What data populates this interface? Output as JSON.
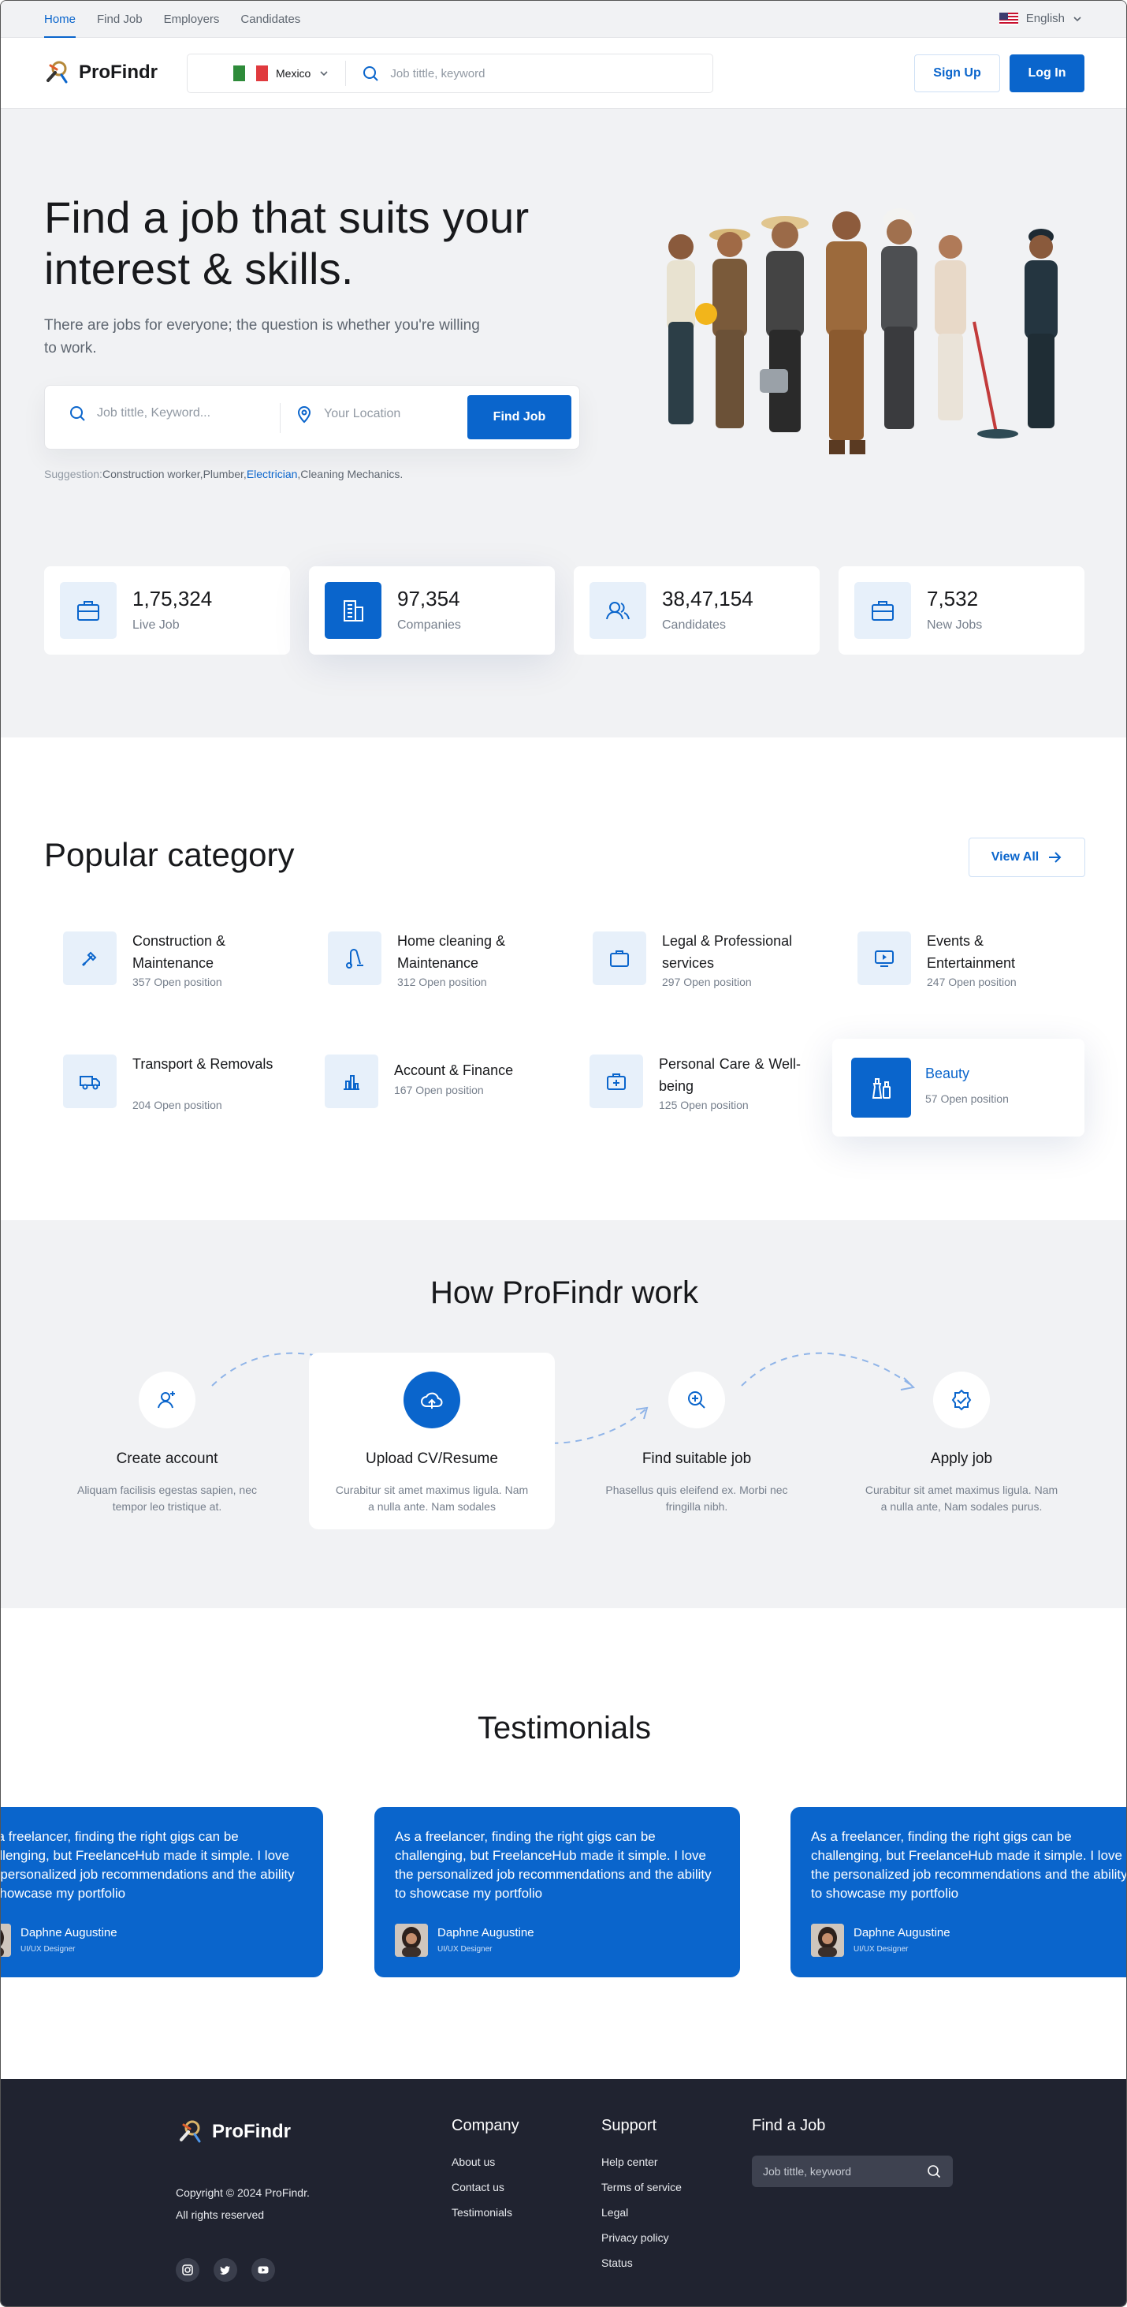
{
  "topnav": {
    "links": [
      "Home",
      "Find Job",
      "Employers",
      "Candidates"
    ],
    "language": "English"
  },
  "header": {
    "brand": "ProFindr",
    "country": "Mexico",
    "search_placeholder": "Job tittle, keyword",
    "signup": "Sign Up",
    "login": "Log In"
  },
  "hero": {
    "title": "Find a job that suits your interest & skills.",
    "subtitle": "There are jobs for everyone; the question is whether you're willing to work.",
    "job_placeholder": "Job tittle, Keyword...",
    "location_placeholder": "Your Location",
    "find_button": "Find Job",
    "suggestion_label": "Suggestion:",
    "suggestions": [
      "Construction worker,",
      "Plumber,",
      "Electrician",
      ",Cleaning Mechanics."
    ]
  },
  "stats": [
    {
      "value": "1,75,324",
      "label": "Live Job",
      "icon": "briefcase-icon"
    },
    {
      "value": "97,354",
      "label": "Companies",
      "icon": "building-icon"
    },
    {
      "value": "38,47,154",
      "label": "Candidates",
      "icon": "users-icon"
    },
    {
      "value": "7,532",
      "label": "New Jobs",
      "icon": "briefcase-icon"
    }
  ],
  "popular": {
    "title": "Popular category",
    "view_all": "View All",
    "categories": [
      {
        "name": "Construction & Maintenance",
        "count": "357 Open position",
        "icon": "tool-icon"
      },
      {
        "name": "Home cleaning & Maintenance",
        "count": "312 Open position",
        "icon": "vacuum-icon"
      },
      {
        "name": "Legal & Professional services",
        "count": "297 Open position",
        "icon": "briefcase-icon"
      },
      {
        "name": "Events & Entertainment",
        "count": "247 Open position",
        "icon": "play-screen-icon"
      },
      {
        "name": "Transport & Removals",
        "count": "204 Open position",
        "icon": "truck-icon"
      },
      {
        "name": "Account & Finance",
        "count": "167 Open position",
        "icon": "bar-chart-icon"
      },
      {
        "name": "Personal Care & Well-being",
        "count": "125 Open position",
        "icon": "first-aid-icon"
      },
      {
        "name": "Beauty",
        "count": "57 Open position",
        "icon": "beauty-icon"
      }
    ]
  },
  "how": {
    "title": "How ProFindr work",
    "steps": [
      {
        "title": "Create account",
        "desc": "Aliquam facilisis egestas sapien, nec tempor leo tristique at.",
        "icon": "user-plus-icon"
      },
      {
        "title": "Upload CV/Resume",
        "desc": "Curabitur sit amet maximus ligula. Nam a nulla ante. Nam sodales",
        "icon": "cloud-upload-icon"
      },
      {
        "title": "Find suitable job",
        "desc": "Phasellus quis eleifend ex. Morbi nec fringilla nibh.",
        "icon": "search-plus-icon"
      },
      {
        "title": "Apply job",
        "desc": "Curabitur sit amet maximus ligula. Nam a nulla ante, Nam sodales purus.",
        "icon": "badge-check-icon"
      }
    ]
  },
  "testimonials": {
    "title": "Testimonials",
    "items": [
      {
        "quote": "As a freelancer, finding the right gigs can be challenging, but FreelanceHub made it simple. I love the personalized job recommendations and the ability to showcase my portfolio",
        "name": "Daphne Augustine",
        "role": "UI/UX Designer"
      },
      {
        "quote": "As a freelancer, finding the right gigs can be challenging, but FreelanceHub made it simple. I love the personalized job recommendations and the ability to showcase my portfolio",
        "name": "Daphne Augustine",
        "role": "UI/UX Designer"
      },
      {
        "quote": "As a freelancer, finding the right gigs can be challenging, but FreelanceHub made it simple. I love the personalized job recommendations and the ability to showcase my portfolio",
        "name": "Daphne Augustine",
        "role": "UI/UX Designer"
      }
    ]
  },
  "footer": {
    "brand": "ProFindr",
    "copyright": "Copyright © 2024 ProFindr.",
    "rights": "All rights reserved",
    "company_title": "Company",
    "company_links": [
      "About us",
      "Contact us",
      "Testimonials"
    ],
    "support_title": "Support",
    "support_links": [
      "Help center",
      "Terms of service",
      "Legal",
      "Privacy policy",
      "Status"
    ],
    "findjob_title": "Find a Job",
    "search_placeholder": "Job tittle, keyword"
  },
  "colors": {
    "primary": "#0a65cc",
    "light": "#e7f0fa",
    "footer": "#202330"
  }
}
